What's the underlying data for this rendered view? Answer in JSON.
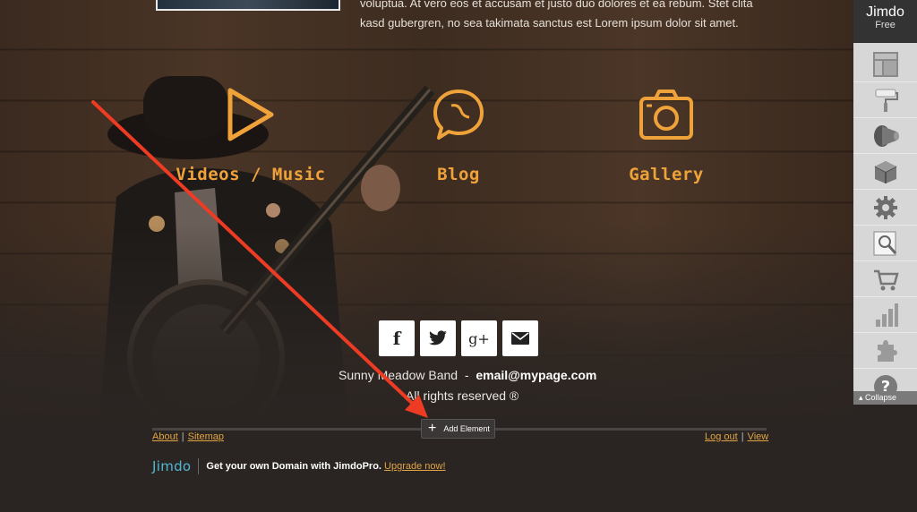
{
  "top_text": {
    "line1": "voluptua. At vero eos et accusam et justo duo dolores et ea rebum. Stet clita",
    "line2": "kasd gubergren, no sea takimata sanctus est Lorem ipsum dolor sit amet."
  },
  "features": [
    {
      "label": "Videos / Music",
      "icon": "play-icon"
    },
    {
      "label": "Blog",
      "icon": "speech-bubble-icon"
    },
    {
      "label": "Gallery",
      "icon": "camera-icon"
    }
  ],
  "social": {
    "facebook": "f",
    "googleplus": "g+"
  },
  "contact": {
    "band": "Sunny Meadow Band",
    "separator": "-",
    "email": "email@mypage.com",
    "rights": "All rights reserved ®"
  },
  "footer": {
    "add_element": "Add Element",
    "about": "About",
    "sitemap": "Sitemap",
    "logout": "Log out",
    "view": "View",
    "link_sep": "|",
    "jimdo_logo": "Jimdo",
    "promo_text": "Get your own Domain with JimdoPro.",
    "upgrade": "Upgrade now!"
  },
  "sidebar": {
    "brand": "Jimdo",
    "plan": "Free",
    "tools": [
      "layout-icon",
      "paint-roller-icon",
      "megaphone-icon",
      "box-icon",
      "gear-icon",
      "seo-icon",
      "cart-icon",
      "stats-icon",
      "puzzle-icon",
      "help-icon"
    ],
    "collapse": "Collapse"
  },
  "colors": {
    "accent": "#f0a23a",
    "link": "#e0a443",
    "arrow": "#ee3b24"
  }
}
